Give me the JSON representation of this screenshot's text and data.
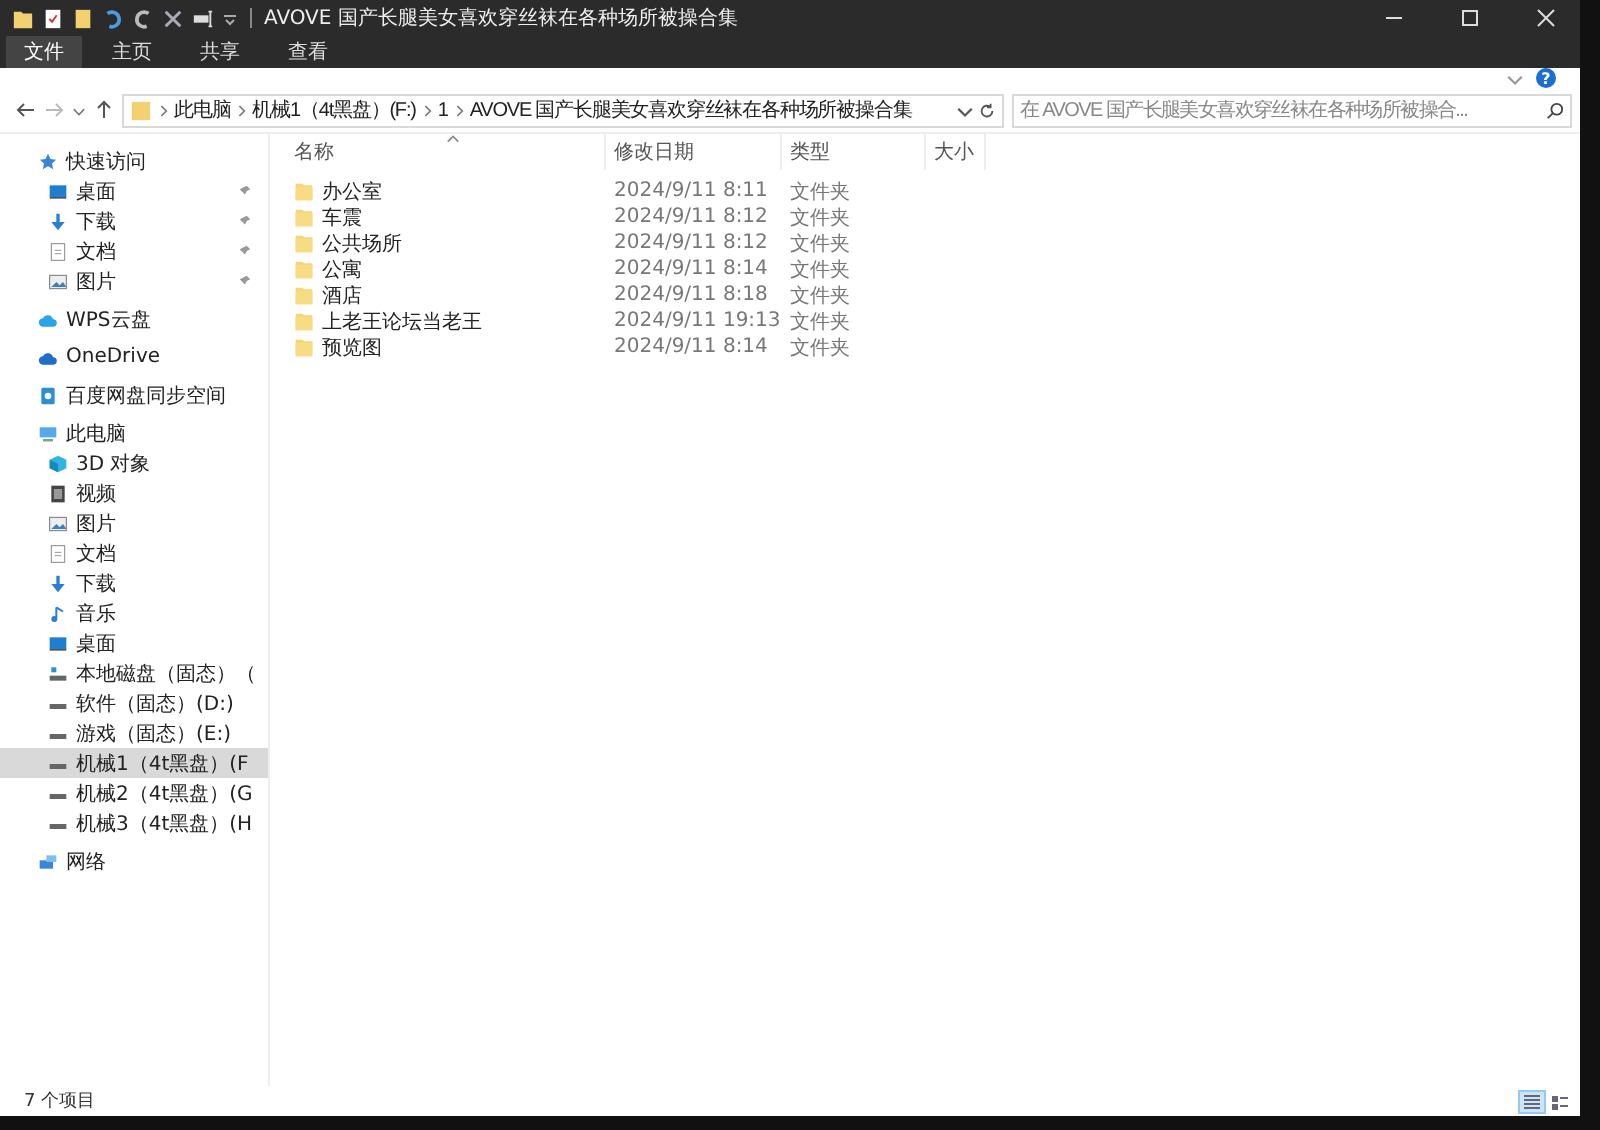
{
  "window": {
    "title": "AVOVE 国产长腿美女喜欢穿丝袜在各种场所被操合集"
  },
  "ribbon": {
    "tabs": [
      {
        "label": "文件",
        "kind": "menu"
      },
      {
        "label": "主页",
        "kind": "tab"
      },
      {
        "label": "共享",
        "kind": "tab"
      },
      {
        "label": "查看",
        "kind": "tab"
      }
    ],
    "help": "?"
  },
  "address": {
    "path": [
      "此电脑",
      "机械1（4t黑盘）(F:)",
      "1",
      "AVOVE 国产长腿美女喜欢穿丝袜在各种场所被操合集"
    ]
  },
  "search": {
    "placeholder": "在 AVOVE 国产长腿美女喜欢穿丝袜在各种场所被操合..."
  },
  "sidebar": {
    "items": [
      {
        "label": "快速访问",
        "kind": "star",
        "selected": false,
        "children": [
          {
            "label": "桌面",
            "kind": "desktop",
            "pinned": true,
            "selected": false
          },
          {
            "label": "下载",
            "kind": "download",
            "pinned": true,
            "selected": false
          },
          {
            "label": "文档",
            "kind": "document",
            "pinned": true,
            "selected": false
          },
          {
            "label": "图片",
            "kind": "picture",
            "pinned": true,
            "selected": false
          }
        ]
      },
      {
        "label": "WPS云盘",
        "kind": "cloud",
        "selected": false
      },
      {
        "label": "OneDrive",
        "kind": "cloud",
        "selected": false
      },
      {
        "label": "百度网盘同步空间",
        "kind": "sync",
        "selected": false
      },
      {
        "label": "此电脑",
        "kind": "computer",
        "selected": false,
        "children": [
          {
            "label": "3D 对象",
            "kind": "cube",
            "pinned": false,
            "selected": false
          },
          {
            "label": "视频",
            "kind": "video",
            "pinned": false,
            "selected": false
          },
          {
            "label": "图片",
            "kind": "picture",
            "pinned": false,
            "selected": false
          },
          {
            "label": "文档",
            "kind": "document",
            "pinned": false,
            "selected": false
          },
          {
            "label": "下载",
            "kind": "download",
            "pinned": false,
            "selected": false
          },
          {
            "label": "音乐",
            "kind": "music",
            "pinned": false,
            "selected": false
          },
          {
            "label": "桌面",
            "kind": "desktop",
            "pinned": false,
            "selected": false
          },
          {
            "label": "本地磁盘（固态）（",
            "kind": "system-drive",
            "pinned": false,
            "selected": false
          },
          {
            "label": "软件（固态）(D:)",
            "kind": "drive",
            "pinned": false,
            "selected": false
          },
          {
            "label": "游戏（固态）(E:)",
            "kind": "drive",
            "pinned": false,
            "selected": false
          },
          {
            "label": "机械1（4t黑盘）(F",
            "kind": "drive",
            "pinned": false,
            "selected": true
          },
          {
            "label": "机械2（4t黑盘）(G",
            "kind": "drive",
            "pinned": false,
            "selected": false
          },
          {
            "label": "机械3（4t黑盘）(H",
            "kind": "drive",
            "pinned": false,
            "selected": false
          }
        ]
      },
      {
        "label": "网络",
        "kind": "network",
        "selected": false
      }
    ]
  },
  "table": {
    "columns": [
      {
        "label": "名称",
        "sorted": true
      },
      {
        "label": "修改日期",
        "sorted": false
      },
      {
        "label": "类型",
        "sorted": false
      },
      {
        "label": "大小",
        "sorted": false
      }
    ],
    "rows": [
      {
        "name": "办公室",
        "modified": "2024/9/11 8:11",
        "type": "文件夹"
      },
      {
        "name": "车震",
        "modified": "2024/9/11 8:12",
        "type": "文件夹"
      },
      {
        "name": "公共场所",
        "modified": "2024/9/11 8:12",
        "type": "文件夹"
      },
      {
        "name": "公寓",
        "modified": "2024/9/11 8:14",
        "type": "文件夹"
      },
      {
        "name": "酒店",
        "modified": "2024/9/11 8:18",
        "type": "文件夹"
      },
      {
        "name": "上老王论坛当老王",
        "modified": "2024/9/11 19:13",
        "type": "文件夹"
      },
      {
        "name": "预览图",
        "modified": "2024/9/11 8:14",
        "type": "文件夹"
      }
    ]
  },
  "status_bar": {
    "text": "7 个项目",
    "views": [
      {
        "kind": "details",
        "selected": true
      },
      {
        "kind": "tiles",
        "selected": false
      }
    ]
  }
}
